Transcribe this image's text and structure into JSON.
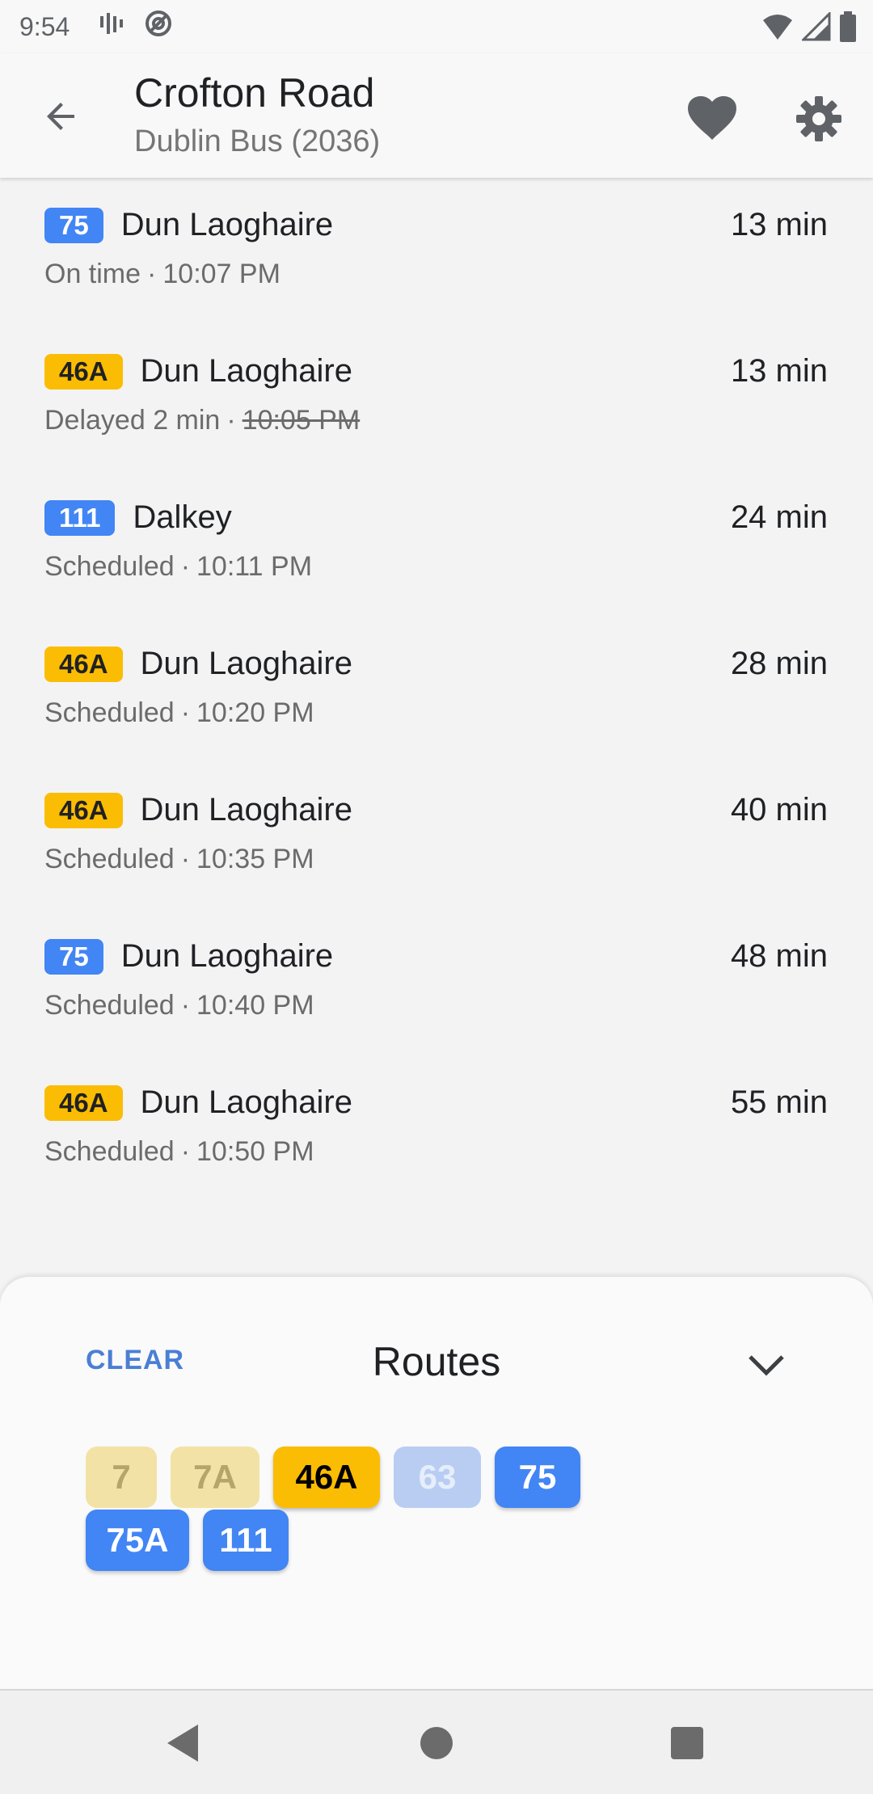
{
  "status_bar": {
    "time": "9:54",
    "icons_left": [
      "voicemail-icon",
      "at-sign-icon"
    ],
    "icons_right": [
      "wifi-icon",
      "signal-icon",
      "battery-icon"
    ]
  },
  "app_bar": {
    "title": "Crofton Road",
    "subtitle": "Dublin Bus (2036)",
    "icons": [
      "back-arrow-icon",
      "heart-icon",
      "gear-icon"
    ]
  },
  "departures": [
    {
      "route": "75",
      "color": "blue",
      "destination": "Dun Laoghaire",
      "eta": "13 min",
      "status": "On time",
      "time": "10:07 PM",
      "time_struck": false
    },
    {
      "route": "46A",
      "color": "yellow",
      "destination": "Dun Laoghaire",
      "eta": "13 min",
      "status": "Delayed 2 min",
      "time": "10:05 PM",
      "time_struck": true
    },
    {
      "route": "111",
      "color": "blue",
      "destination": "Dalkey",
      "eta": "24 min",
      "status": "Scheduled",
      "time": "10:11 PM",
      "time_struck": false
    },
    {
      "route": "46A",
      "color": "yellow",
      "destination": "Dun Laoghaire",
      "eta": "28 min",
      "status": "Scheduled",
      "time": "10:20 PM",
      "time_struck": false
    },
    {
      "route": "46A",
      "color": "yellow",
      "destination": "Dun Laoghaire",
      "eta": "40 min",
      "status": "Scheduled",
      "time": "10:35 PM",
      "time_struck": false
    },
    {
      "route": "75",
      "color": "blue",
      "destination": "Dun Laoghaire",
      "eta": "48 min",
      "status": "Scheduled",
      "time": "10:40 PM",
      "time_struck": false
    },
    {
      "route": "46A",
      "color": "yellow",
      "destination": "Dun Laoghaire",
      "eta": "55 min",
      "status": "Scheduled",
      "time": "10:50 PM",
      "time_struck": false
    }
  ],
  "routes_sheet": {
    "clear_label": "CLEAR",
    "title": "Routes",
    "collapse_icon": "chevron-down-icon",
    "chips": [
      {
        "label": "7",
        "color": "yellow",
        "selected": false
      },
      {
        "label": "7A",
        "color": "yellow",
        "selected": false
      },
      {
        "label": "46A",
        "color": "yellow",
        "selected": true
      },
      {
        "label": "63",
        "color": "blue",
        "selected": false
      },
      {
        "label": "75",
        "color": "blue",
        "selected": true
      },
      {
        "label": "75A",
        "color": "blue",
        "selected": true
      },
      {
        "label": "111",
        "color": "blue",
        "selected": true
      }
    ]
  },
  "nav_bar": {
    "icons": [
      "nav-back-icon",
      "nav-home-icon",
      "nav-recents-icon"
    ]
  },
  "colors": {
    "route_blue": "#4285f4",
    "route_yellow": "#fbbc04",
    "accent": "#4a7fd4"
  }
}
